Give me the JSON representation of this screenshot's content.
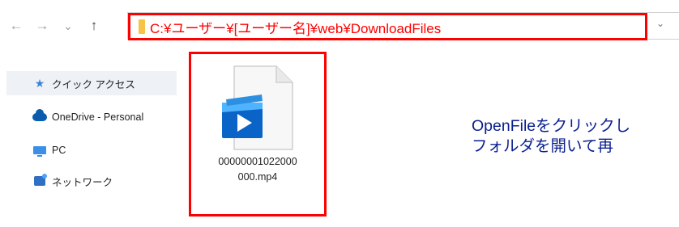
{
  "toolbar": {
    "back_icon": "←",
    "forward_icon": "→",
    "recent_icon": "⌄",
    "up_icon": "↑",
    "address_path": "C:¥ユーザー¥[ユーザー名]¥web¥DownloadFiles",
    "dropdown_icon": "⌄"
  },
  "sidebar": {
    "items": [
      {
        "label": "クイック アクセス",
        "icon": "star-icon"
      },
      {
        "label": "OneDrive - Personal",
        "icon": "cloud-icon"
      },
      {
        "label": "PC",
        "icon": "computer-icon"
      },
      {
        "label": "ネットワーク",
        "icon": "network-icon"
      }
    ]
  },
  "file": {
    "name_line1": "00000001022000",
    "name_line2": "000.mp4",
    "icon": "video-file-icon"
  },
  "note": {
    "line1": "OpenFileをクリックし",
    "line2": "フォルダを開いて再"
  },
  "colors": {
    "highlight": "#ff0000",
    "note_text": "#0a1f8f",
    "folder": "#f6c344"
  }
}
